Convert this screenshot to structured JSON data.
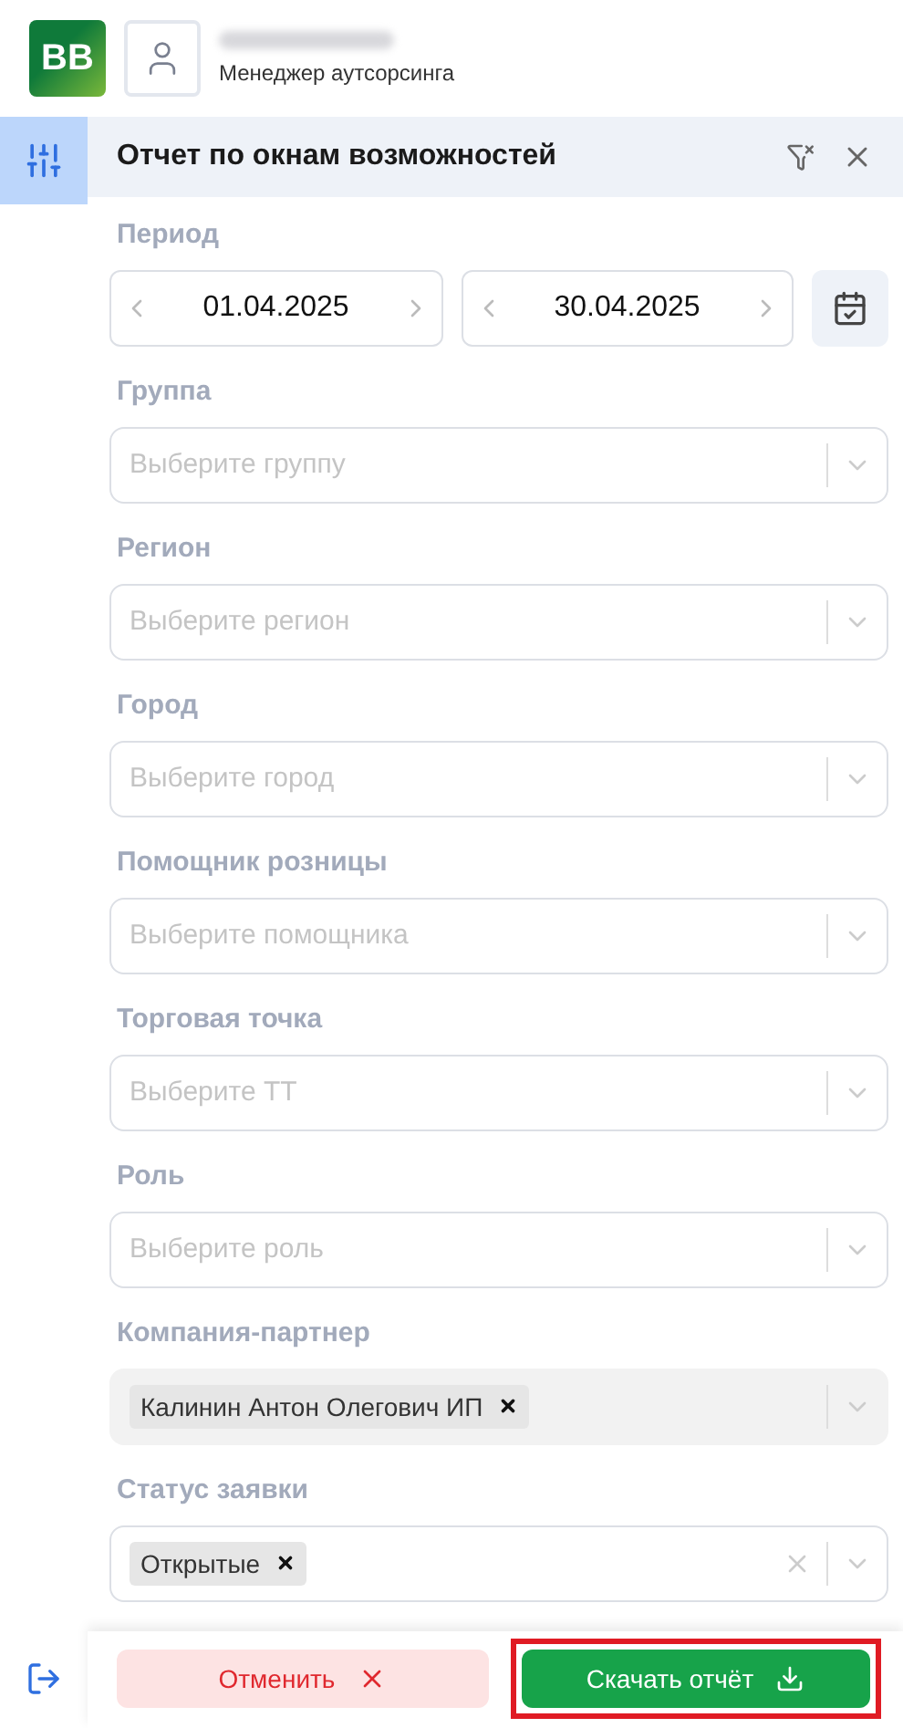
{
  "header": {
    "logo": "BB",
    "role": "Менеджер аутсорсинга"
  },
  "panel": {
    "title": "Отчет по окнам возможностей",
    "filters_tab_selected": true
  },
  "fields": [
    {
      "kind": "date_range",
      "label": "Период",
      "from": "01.04.2025",
      "to": "30.04.2025"
    },
    {
      "kind": "select",
      "label": "Группа",
      "placeholder": "Выберите группу",
      "disabled": false
    },
    {
      "kind": "select",
      "label": "Регион",
      "placeholder": "Выберите регион",
      "disabled": false
    },
    {
      "kind": "select",
      "label": "Город",
      "placeholder": "Выберите город",
      "disabled": false
    },
    {
      "kind": "select",
      "label": "Помощник розницы",
      "placeholder": "Выберите помощника",
      "disabled": false
    },
    {
      "kind": "select",
      "label": "Торговая точка",
      "placeholder": "Выберите ТТ",
      "disabled": false
    },
    {
      "kind": "select",
      "label": "Роль",
      "placeholder": "Выберите роль",
      "disabled": false
    },
    {
      "kind": "select",
      "label": "Компания-партнер",
      "disabled": true,
      "tags": [
        "Калинин Антон Олегович ИП"
      ]
    },
    {
      "kind": "select",
      "label": "Статус заявки",
      "disabled": false,
      "clearable": true,
      "tags": [
        "Открытые"
      ]
    }
  ],
  "footer": {
    "cancel": "Отменить",
    "download": "Скачать отчёт",
    "download_highlighted": true
  }
}
